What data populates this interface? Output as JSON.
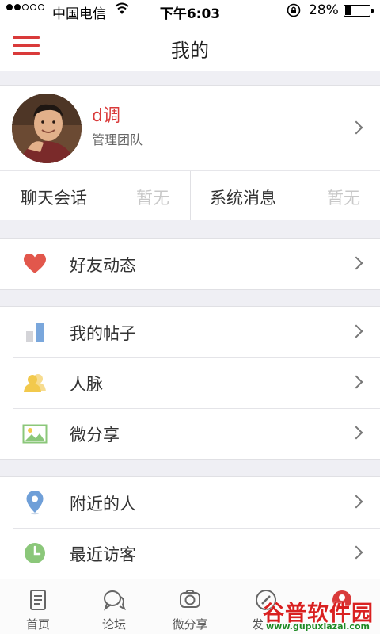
{
  "status_bar": {
    "carrier": "中国电信",
    "time": "下午6:03",
    "battery": "28%",
    "battery_level": 0.28
  },
  "header": {
    "title": "我的"
  },
  "profile": {
    "name": "d调",
    "role": "管理团队"
  },
  "messages": [
    {
      "label": "聊天会话",
      "value": "暂无"
    },
    {
      "label": "系统消息",
      "value": "暂无"
    }
  ],
  "groups": [
    [
      {
        "label": "好友动态",
        "icon": "heart-icon"
      }
    ],
    [
      {
        "label": "我的帖子",
        "icon": "bar-chart-icon"
      },
      {
        "label": "人脉",
        "icon": "contacts-icon"
      },
      {
        "label": "微分享",
        "icon": "picture-icon"
      }
    ],
    [
      {
        "label": "附近的人",
        "icon": "location-pin-icon"
      },
      {
        "label": "最近访客",
        "icon": "clock-icon"
      }
    ]
  ],
  "tabs": [
    {
      "label": "首页",
      "icon": "document-icon"
    },
    {
      "label": "论坛",
      "icon": "chat-bubbles-icon"
    },
    {
      "label": "微分享",
      "icon": "camera-frame-icon"
    },
    {
      "label": "发",
      "icon": "post-icon"
    },
    {
      "label": "",
      "icon": "me-icon"
    }
  ],
  "watermark": {
    "name": "谷普软件园",
    "url": "www.gupuxiazai.com"
  },
  "colors": {
    "accent": "#d93a3a",
    "background": "#efeff4",
    "heart": "#e2574c",
    "bar": "#7aa7dc",
    "contacts": "#f2c94c",
    "pin": "#6f9fd8",
    "clock": "#8bc77a"
  }
}
